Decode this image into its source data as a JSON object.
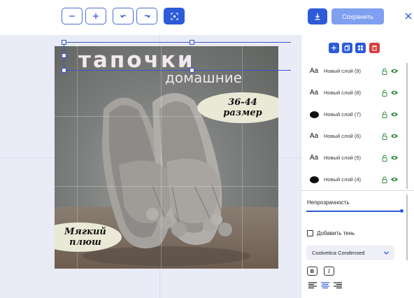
{
  "toolbar": {
    "zoom_out_icon": "minus-icon",
    "zoom_in_icon": "plus-icon",
    "undo_icon": "undo-icon",
    "redo_icon": "redo-icon",
    "fit_icon": "fit-screen-icon",
    "download_icon": "download-icon",
    "save_label": "Сохранить",
    "close_icon": "close-icon",
    "accent_color": "#2c5ad9",
    "save_color": "#7f9ff0"
  },
  "canvas": {
    "title_main": "тапочки",
    "title_sub": "домашние",
    "bubble_top_line1": "36-44",
    "bubble_top_line2": "размер",
    "bubble_bottom_line1": "Мягкий",
    "bubble_bottom_line2": "плюш",
    "bubble_color": "#e9e9d6"
  },
  "panel": {
    "tools": [
      "add-icon",
      "duplicate-icon",
      "ungroup-icon",
      "delete-icon"
    ],
    "layers": [
      {
        "type": "text",
        "thumb": "Aa",
        "name": "Новый слой (9)"
      },
      {
        "type": "text",
        "thumb": "Aa",
        "name": "Новый слой (8)"
      },
      {
        "type": "shape",
        "thumb": "",
        "name": "Новый слой (7)"
      },
      {
        "type": "text",
        "thumb": "Aa",
        "name": "Новый слой (6)"
      },
      {
        "type": "text",
        "thumb": "Aa",
        "name": "Новый слой (5)"
      },
      {
        "type": "shape",
        "thumb": "",
        "name": "Новый слой (4)"
      }
    ],
    "opacity_label": "Непрозрачность",
    "opacity_value": 1.0,
    "shadow_label": "Добавить тень",
    "shadow_checked": false,
    "font_family": "Coolvetica Condensed",
    "bold_label": "B",
    "italic_label": "I",
    "alignment": "center",
    "status_color": "#2e8b3a"
  }
}
